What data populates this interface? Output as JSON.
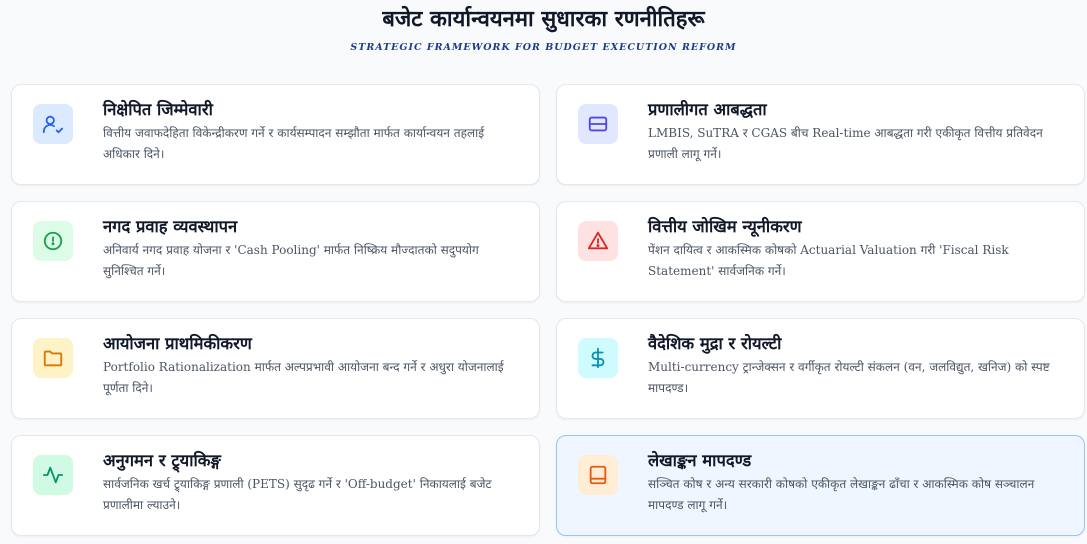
{
  "header": {
    "title": "बजेट कार्यान्वयनमा सुधारका रणनीतिहरू",
    "subtitle": "STRATEGIC FRAMEWORK FOR BUDGET EXECUTION REFORM"
  },
  "cards": [
    {
      "title": "निक्षेपित जिम्मेवारी",
      "desc": "वित्तीय जवाफदेहिता विकेन्द्रीकरण गर्ने र कार्यसम्पादन सम्झौता मार्फत कार्यान्वयन तहलाई अधिकार दिने।",
      "icon": "user-check-icon",
      "icon_color": "#2563eb",
      "icon_bg": "#dbeafe"
    },
    {
      "title": "प्रणालीगत आबद्धता",
      "desc": "LMBIS, SuTRA र CGAS बीच Real-time आबद्धता गरी एकीकृत वित्तीय प्रतिवेदन प्रणाली लागू गर्ने।",
      "icon": "credit-card-icon",
      "icon_color": "#4f46e5",
      "icon_bg": "#e0e7ff"
    },
    {
      "title": "नगद प्रवाह व्यवस्थापन",
      "desc": "अनिवार्य नगद प्रवाह योजना र 'Cash Pooling' मार्फत निष्क्रिय मौज्दातको सदुपयोग सुनिश्चित गर्ने।",
      "icon": "clock-icon",
      "icon_color": "#16a34a",
      "icon_bg": "#dcfce7"
    },
    {
      "title": "वित्तीय जोखिम न्यूनीकरण",
      "desc": "पेंशन दायित्व र आकस्मिक कोषको Actuarial Valuation गरी 'Fiscal Risk Statement' सार्वजनिक गर्ने।",
      "icon": "warning-triangle-icon",
      "icon_color": "#dc2626",
      "icon_bg": "#fee2e2"
    },
    {
      "title": "आयोजना प्राथमिकीकरण",
      "desc": "Portfolio Rationalization मार्फत अल्पप्रभावी आयोजना बन्द गर्ने र अधुरा योजनालाई पूर्णता दिने।",
      "icon": "folder-icon",
      "icon_color": "#d97706",
      "icon_bg": "#fef3c7"
    },
    {
      "title": "वैदेशिक मुद्रा र रोयल्टी",
      "desc": "Multi-currency ट्रान्जेक्सन र वर्गीकृत रोयल्टी संकलन (वन, जलविद्युत, खनिज) को स्पष्ट मापदण्ड।",
      "icon": "dollar-icon",
      "icon_color": "#0891b2",
      "icon_bg": "#cffafe"
    },
    {
      "title": "अनुगमन र ट्र्याकिङ्ग",
      "desc": "सार्वजनिक खर्च ट्र्याकिङ्ग प्रणाली (PETS) सुदृढ गर्ने र 'Off-budget' निकायलाई बजेट प्रणालीमा ल्याउने।",
      "icon": "activity-icon",
      "icon_color": "#059669",
      "icon_bg": "#d1fae5"
    },
    {
      "title": "लेखाङ्कन मापदण्ड",
      "desc": "सञ्चित कोष र अन्य सरकारी कोषको एकीकृत लेखाङ्कन ढाँचा र आकस्मिक कोष सञ्चालन मापदण्ड लागू गर्ने।",
      "icon": "book-icon",
      "icon_color": "#ea580c",
      "icon_bg": "#ffedd5"
    }
  ]
}
